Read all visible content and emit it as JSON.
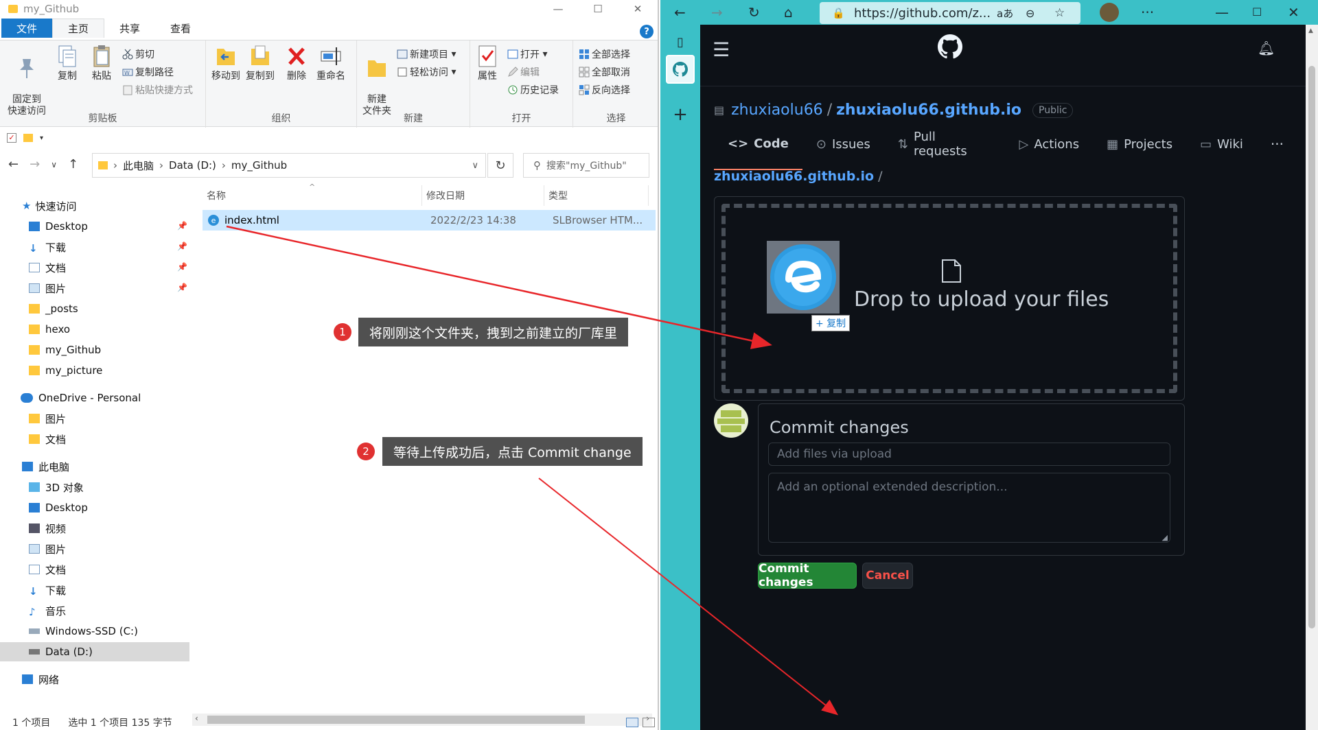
{
  "explorer": {
    "window_title": "my_Github",
    "ribbon_tabs": [
      "文件",
      "主页",
      "共享",
      "查看"
    ],
    "clipboard": {
      "pin_label": "固定到\n快速访问",
      "copy_label": "复制",
      "paste_label": "粘贴",
      "cut_label": "剪切",
      "copy_path_label": "复制路径",
      "paste_shortcut_label": "粘贴快捷方式",
      "group_label": "剪贴板"
    },
    "organize": {
      "move_to_label": "移动到",
      "copy_to_label": "复制到",
      "delete_label": "删除",
      "rename_label": "重命名",
      "group_label": "组织"
    },
    "new": {
      "new_folder_label": "新建\n文件夹",
      "new_item_label": "新建项目",
      "easy_access_label": "轻松访问",
      "group_label": "新建"
    },
    "open": {
      "properties_label": "属性",
      "open_label": "打开",
      "edit_label": "编辑",
      "history_label": "历史记录",
      "group_label": "打开"
    },
    "select": {
      "select_all_label": "全部选择",
      "select_none_label": "全部取消",
      "invert_label": "反向选择",
      "group_label": "选择"
    },
    "address": {
      "segments": [
        "此电脑",
        "Data (D:)",
        "my_Github"
      ],
      "search_placeholder": "搜索\"my_Github\""
    },
    "nav": {
      "quick_access": "快速访问",
      "quick_items": [
        "Desktop",
        "下载",
        "文档",
        "图片",
        "_posts",
        "hexo",
        "my_Github",
        "my_picture"
      ],
      "onedrive": "OneDrive - Personal",
      "onedrive_items": [
        "图片",
        "文档"
      ],
      "this_pc": "此电脑",
      "pc_items": [
        "3D 对象",
        "Desktop",
        "视频",
        "图片",
        "文档",
        "下载",
        "音乐",
        "Windows-SSD (C:)",
        "Data (D:)"
      ],
      "network": "网络"
    },
    "columns": [
      "名称",
      "修改日期",
      "类型"
    ],
    "file": {
      "name": "index.html",
      "modified": "2022/2/23 14:38",
      "type": "SLBrowser HTM..."
    },
    "status": {
      "count": "1 个项目",
      "selected": "选中 1 个项目 135 字节"
    }
  },
  "annotations": {
    "step1_num": "1",
    "step1_text": "将刚刚这个文件夹，拽到之前建立的厂库里",
    "step2_num": "2",
    "step2_text": "等待上传成功后，点击 Commit change",
    "arrow_color": "#e8262a"
  },
  "browser": {
    "url": "https://github.com/z...",
    "read_aloud": "aあ"
  },
  "github": {
    "owner": "zhuxiaolu66",
    "separator": "/",
    "repo": "zhuxiaolu66.github.io",
    "visibility": "Public",
    "tabs": [
      "Code",
      "Issues",
      "Pull requests",
      "Actions",
      "Projects",
      "Wiki"
    ],
    "more_label": "···",
    "breadcrumb_repo": "zhuxiaolu66.github.io",
    "breadcrumb_sep": "/",
    "drop_text": "Drop to upload your files",
    "copy_badge": "+ 复制",
    "commit_title": "Commit changes",
    "commit_placeholder": "Add files via upload",
    "desc_placeholder": "Add an optional extended description...",
    "commit_button": "Commit changes",
    "cancel_button": "Cancel",
    "accent_green": "#238636",
    "link_blue": "#58a6ff"
  }
}
